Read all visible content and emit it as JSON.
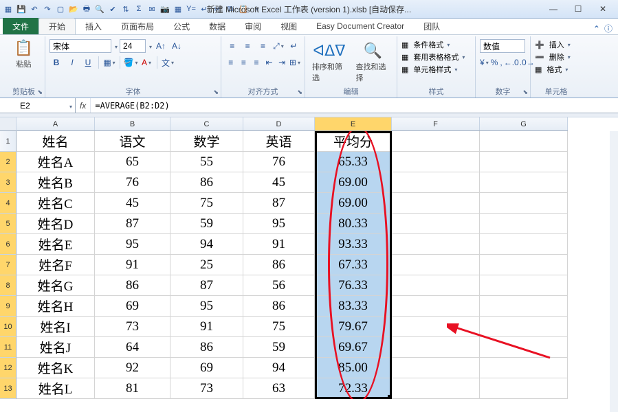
{
  "titlebar": {
    "title": "新建 Microsoft Excel 工作表 (version 1).xlsb [自动保存...",
    "qat_icons": [
      "excel-icon",
      "save-icon",
      "undo-icon",
      "redo-icon",
      "new-icon",
      "open-icon",
      "print-icon",
      "preview-icon",
      "spell-icon",
      "sort-icon",
      "autosum-icon",
      "mail-icon",
      "camera-icon",
      "calc-icon",
      "formula-icon",
      "wrap-icon",
      "cut-icon",
      "copy-icon",
      "paste-icon",
      "qat-more"
    ],
    "min": "—",
    "max": "☐",
    "close": "✕"
  },
  "tabs": {
    "file": "文件",
    "items": [
      "开始",
      "插入",
      "页面布局",
      "公式",
      "数据",
      "审阅",
      "视图",
      "Easy Document Creator",
      "团队"
    ],
    "active": 0,
    "help": "ⓘ"
  },
  "ribbon": {
    "clipboard": {
      "paste": "粘贴",
      "label": "剪贴板"
    },
    "font": {
      "name": "宋体",
      "size": "24",
      "label": "字体"
    },
    "alignment": {
      "label": "对齐方式"
    },
    "editing": {
      "sort": "排序和筛选",
      "find": "查找和选择",
      "label": "编辑"
    },
    "styles": {
      "cond": "条件格式",
      "table": "套用表格格式",
      "cell": "单元格样式",
      "label": "样式"
    },
    "number": {
      "format": "数值",
      "label": "数字"
    },
    "cells": {
      "insert": "插入",
      "delete": "删除",
      "format": "格式",
      "label": "单元格"
    }
  },
  "formula_bar": {
    "name_box": "E2",
    "fx": "fx",
    "formula": "=AVERAGE(B2:D2)"
  },
  "columns": [
    "A",
    "B",
    "C",
    "D",
    "E",
    "F",
    "G"
  ],
  "row_numbers": [
    1,
    2,
    3,
    4,
    5,
    6,
    7,
    8,
    9,
    10,
    11,
    12,
    13
  ],
  "chart_data": {
    "type": "table",
    "headers": [
      "姓名",
      "语文",
      "数学",
      "英语",
      "平均分"
    ],
    "rows": [
      [
        "姓名A",
        65,
        55,
        76,
        "65.33"
      ],
      [
        "姓名B",
        76,
        86,
        45,
        "69.00"
      ],
      [
        "姓名C",
        45,
        75,
        87,
        "69.00"
      ],
      [
        "姓名D",
        87,
        59,
        95,
        "80.33"
      ],
      [
        "姓名E",
        95,
        94,
        91,
        "93.33"
      ],
      [
        "姓名F",
        91,
        25,
        86,
        "67.33"
      ],
      [
        "姓名G",
        86,
        87,
        56,
        "76.33"
      ],
      [
        "姓名H",
        69,
        95,
        86,
        "83.33"
      ],
      [
        "姓名I",
        73,
        91,
        75,
        "79.67"
      ],
      [
        "姓名J",
        64,
        86,
        59,
        "69.67"
      ],
      [
        "姓名K",
        92,
        69,
        94,
        "85.00"
      ],
      [
        "姓名L",
        81,
        73,
        63,
        "72.33"
      ]
    ]
  },
  "icons": {
    "bold": "B",
    "italic": "I",
    "underline": "U"
  }
}
